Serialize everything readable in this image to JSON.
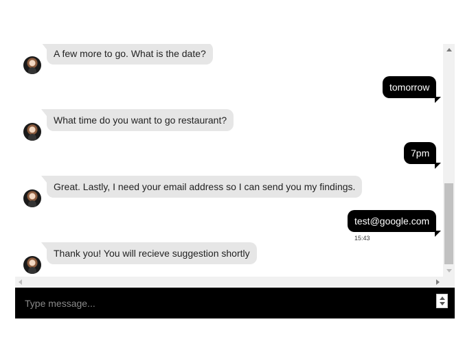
{
  "chat": {
    "messages": [
      {
        "sender": "bot",
        "text": "A few more to go. What is the date?"
      },
      {
        "sender": "user",
        "text": "tomorrow"
      },
      {
        "sender": "bot",
        "text": "What time do you want to go restaurant?"
      },
      {
        "sender": "user",
        "text": "7pm"
      },
      {
        "sender": "bot",
        "text": "Great. Lastly, I need your email address so I can send you my findings."
      },
      {
        "sender": "user",
        "text": "test@google.com",
        "time": "15:43"
      },
      {
        "sender": "bot",
        "text": "Thank you! You will recieve suggestion shortly"
      }
    ]
  },
  "input": {
    "placeholder": "Type message...",
    "value": ""
  },
  "icons": {
    "avatar": "bot-avatar-icon",
    "scroll_up": "arrow-up-icon",
    "scroll_down": "arrow-down-icon",
    "scroll_left": "arrow-left-icon",
    "scroll_right": "arrow-right-icon"
  },
  "colors": {
    "bot_bubble": "#e6e6e6",
    "user_bubble": "#000000",
    "input_bar": "#000000"
  }
}
